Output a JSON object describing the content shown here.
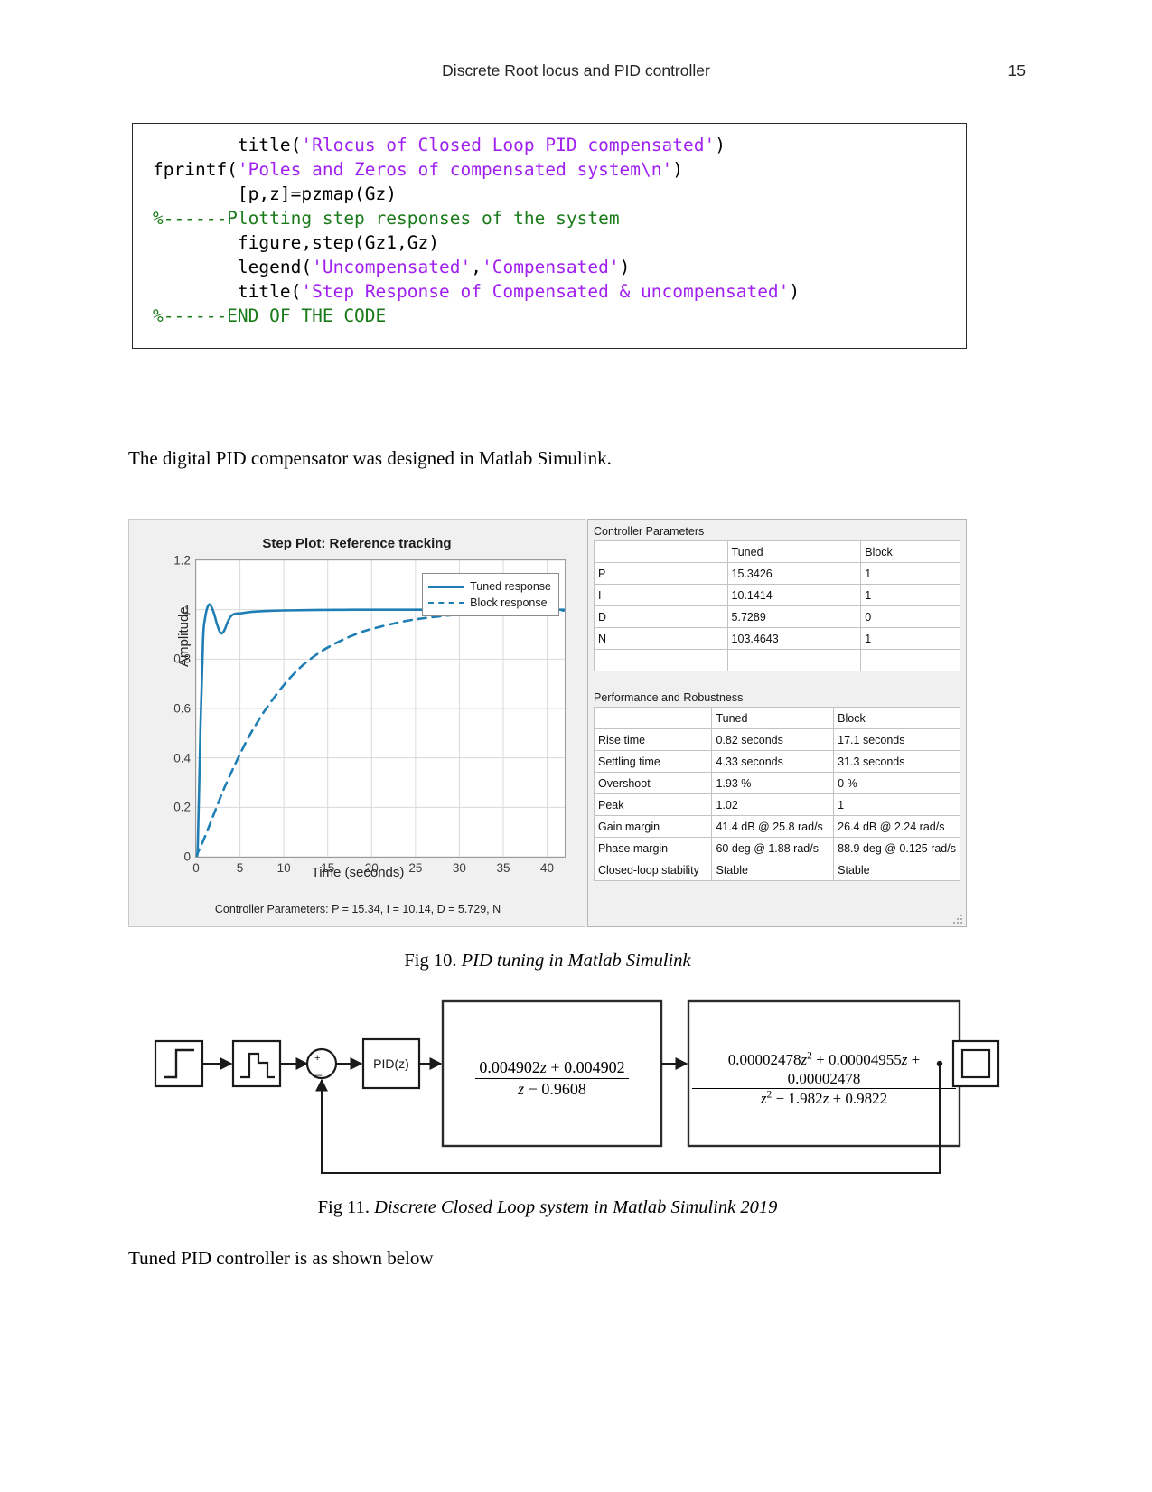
{
  "header": {
    "title": "Discrete Root locus and PID controller",
    "page_number": "15"
  },
  "code_block": {
    "lines": [
      [
        {
          "t": "        title(",
          "c": "plain"
        },
        {
          "t": "'Rlocus of Closed Loop PID compensated'",
          "c": "string"
        },
        {
          "t": ")",
          "c": "plain"
        }
      ],
      [
        {
          "t": "fprintf(",
          "c": "plain"
        },
        {
          "t": "'Poles and Zeros of compensated system\\n'",
          "c": "string"
        },
        {
          "t": ")",
          "c": "plain"
        }
      ],
      [
        {
          "t": "        [p,z]=pzmap(Gz)",
          "c": "plain"
        }
      ],
      [
        {
          "t": "%------Plotting step responses of the system",
          "c": "comment"
        }
      ],
      [
        {
          "t": "        figure,step(Gz1,Gz)",
          "c": "plain"
        }
      ],
      [
        {
          "t": "        legend(",
          "c": "plain"
        },
        {
          "t": "'Uncompensated'",
          "c": "string"
        },
        {
          "t": ",",
          "c": "plain"
        },
        {
          "t": "'Compensated'",
          "c": "string"
        },
        {
          "t": ")",
          "c": "plain"
        }
      ],
      [
        {
          "t": "        title(",
          "c": "plain"
        },
        {
          "t": "'Step Response of Compensated & uncompensated'",
          "c": "string"
        },
        {
          "t": ")",
          "c": "plain"
        }
      ],
      [
        {
          "t": "%------END OF THE CODE",
          "c": "comment"
        }
      ]
    ],
    "colors": {
      "string": "#a020f0",
      "comment": "#1a7a1a",
      "plain": "#000000"
    }
  },
  "paragraphs": {
    "designed": "The digital PID compensator was designed in Matlab Simulink.",
    "tuned": "Tuned PID controller is as shown below"
  },
  "chart_data": {
    "type": "line",
    "title": "Step Plot: Reference tracking",
    "xlabel": "Time (seconds)",
    "ylabel": "Amplitude",
    "xlim": [
      0,
      42
    ],
    "ylim": [
      0,
      1.2
    ],
    "xticks": [
      0,
      5,
      10,
      15,
      20,
      25,
      30,
      35,
      40
    ],
    "yticks": [
      0,
      0.2,
      0.4,
      0.6,
      0.8,
      1,
      1.2
    ],
    "ytick_labels": [
      "0",
      "0.2",
      "0.4",
      "0.6",
      "0.8",
      "1",
      "1.2"
    ],
    "grid": true,
    "legend_position": "top-right",
    "line_color": "#1f7fb5",
    "series": [
      {
        "name": "Tuned response",
        "style": "solid",
        "x": [
          0,
          0.2,
          0.5,
          0.8,
          1.0,
          1.3,
          1.6,
          2.0,
          2.4,
          2.8,
          3.2,
          3.6,
          4.0,
          4.5,
          5.0,
          6.0,
          7.0,
          8.0,
          10.0,
          14.0,
          20.0,
          26.0,
          32.0,
          38.0,
          42.0
        ],
        "y": [
          0,
          0.05,
          0.52,
          0.88,
          0.96,
          1.01,
          1.02,
          0.99,
          0.94,
          0.905,
          0.915,
          0.95,
          0.975,
          0.984,
          0.985,
          0.99,
          0.993,
          0.995,
          0.997,
          0.999,
          1.0,
          1.0,
          1.0,
          1.0,
          1.0
        ]
      },
      {
        "name": "Block response",
        "style": "dashed",
        "x": [
          0,
          1,
          2,
          3,
          4,
          5,
          6,
          7,
          8,
          10,
          12,
          14,
          16,
          18,
          20,
          24,
          28,
          32,
          36,
          40,
          42
        ],
        "y": [
          0,
          0.08,
          0.17,
          0.26,
          0.34,
          0.415,
          0.485,
          0.545,
          0.6,
          0.695,
          0.77,
          0.825,
          0.866,
          0.898,
          0.922,
          0.955,
          0.974,
          0.985,
          0.991,
          0.995,
          0.997
        ]
      }
    ],
    "status_text": "Controller Parameters: P = 15.34, I = 10.14, D = 5.729, N"
  },
  "controller_parameters": {
    "panel_title": "Controller Parameters",
    "columns": [
      "",
      "Tuned",
      "Block"
    ],
    "rows": [
      [
        "P",
        "15.3426",
        "1"
      ],
      [
        "I",
        "10.1414",
        "1"
      ],
      [
        "D",
        "5.7289",
        "0"
      ],
      [
        "N",
        "103.4643",
        "1"
      ],
      [
        "",
        "",
        ""
      ]
    ]
  },
  "performance_robustness": {
    "panel_title": "Performance and Robustness",
    "columns": [
      "",
      "Tuned",
      "Block"
    ],
    "rows": [
      [
        "Rise time",
        "0.82 seconds",
        "17.1 seconds"
      ],
      [
        "Settling time",
        "4.33 seconds",
        "31.3 seconds"
      ],
      [
        "Overshoot",
        "1.93 %",
        "0 %"
      ],
      [
        "Peak",
        "1.02",
        "1"
      ],
      [
        "Gain margin",
        "41.4 dB @ 25.8 rad/s",
        "26.4 dB @ 2.24 rad/s"
      ],
      [
        "Phase margin",
        "60 deg @ 1.88 rad/s",
        "88.9 deg @ 0.125 rad/s"
      ],
      [
        "Closed-loop stability",
        "Stable",
        "Stable"
      ]
    ]
  },
  "captions": {
    "fig10_label": "Fig 10.",
    "fig10_text": "PID tuning in Matlab Simulink",
    "fig11_label": "Fig 11.",
    "fig11_text": "Discrete Closed Loop system in Matlab Simulink 2019"
  },
  "simulink_model": {
    "blocks": {
      "step_source": "step-input-icon",
      "zoh": "zero-order-hold-icon",
      "sum_plus": "+",
      "sum_minus": "−",
      "pid_label": "PID(z)",
      "scope": "scope-icon"
    },
    "plant1": {
      "numerator": "0.004902z + 0.004902",
      "denominator": "z − 0.9608"
    },
    "plant2": {
      "numerator": "0.00002478z² + 0.00004955z + 0.00002478",
      "denominator": "z² − 1.982z + 0.9822"
    }
  }
}
